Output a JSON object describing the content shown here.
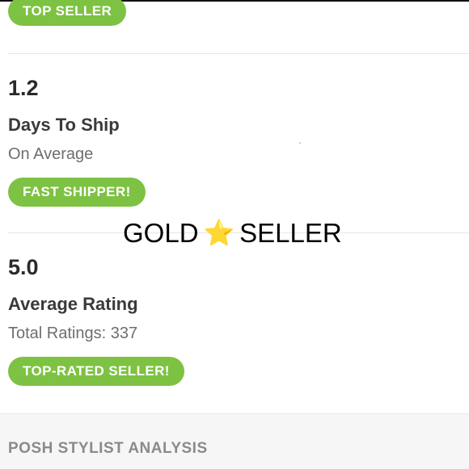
{
  "badges": {
    "top_seller": "TOP SELLER",
    "fast_shipper": "FAST SHIPPER!",
    "top_rated": "TOP-RATED SELLER!"
  },
  "shipping": {
    "value": "1.2",
    "label": "Days To Ship",
    "sub": "On Average"
  },
  "rating": {
    "value": "5.0",
    "label": "Average Rating",
    "sub": "Total Ratings: 337"
  },
  "overlay": {
    "left_text": "GOLD",
    "star": "⭐",
    "right_text": "SELLER"
  },
  "footer": {
    "title": "POSH STYLIST ANALYSIS"
  },
  "colors": {
    "badge": "#7dc242",
    "star": "#f7c325"
  }
}
